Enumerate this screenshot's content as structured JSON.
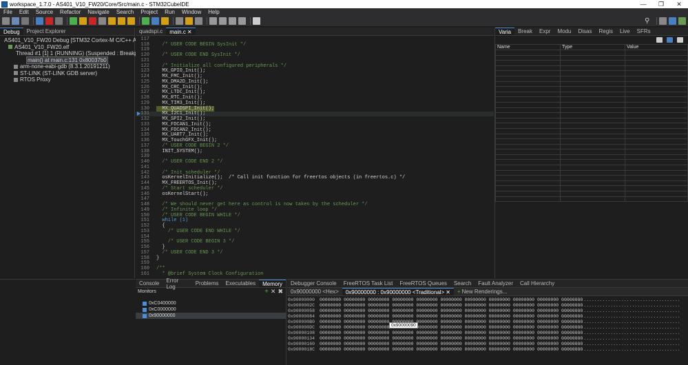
{
  "window": {
    "title": "workspace_1.7.0 - AS401_V10_FW20/Core/Src/main.c - STM32CubeIDE"
  },
  "menu": [
    "File",
    "Edit",
    "Source",
    "Refactor",
    "Navigate",
    "Search",
    "Project",
    "Run",
    "Window",
    "Help"
  ],
  "debug_panel": {
    "tabs": [
      "Debug",
      "Project Explorer"
    ],
    "tree": [
      {
        "label": "AS401_V10_FW20 Debug [STM32 Cortex-M C/C++ Application]",
        "indent": 0
      },
      {
        "label": "AS401_V10_FW20.elf",
        "indent": 1
      },
      {
        "label": "Thread #1 [1] 1 (RUNNING) (Suspended : Breakpoint)",
        "indent": 2
      },
      {
        "label": "main() at main.c:131 0x80037b0",
        "indent": 3
      },
      {
        "label": "arm-none-eabi-gdb (8.3.1.20191211)",
        "indent": 1
      },
      {
        "label": "ST-LINK (ST-LINK GDB server)",
        "indent": 1
      },
      {
        "label": "RTOS Proxy",
        "indent": 1
      }
    ]
  },
  "editor": {
    "tabs": [
      "quadspi.c",
      "main.c"
    ],
    "lines": [
      {
        "n": "117",
        "t": ""
      },
      {
        "n": "118",
        "t": "  /* USER CODE BEGIN SysInit */"
      },
      {
        "n": "119",
        "t": ""
      },
      {
        "n": "120",
        "t": "  /* USER CODE END SysInit */"
      },
      {
        "n": "121",
        "t": ""
      },
      {
        "n": "122",
        "t": "  /* Initialize all configured peripherals */"
      },
      {
        "n": "123",
        "t": "  MX_GPIO_Init();"
      },
      {
        "n": "124",
        "t": "  MX_FMC_Init();"
      },
      {
        "n": "125",
        "t": "  MX_DMA2D_Init();"
      },
      {
        "n": "126",
        "t": "  MX_CRC_Init();"
      },
      {
        "n": "127",
        "t": "  MX_LTDC_Init();"
      },
      {
        "n": "128",
        "t": "  MX_RTC_Init();"
      },
      {
        "n": "129",
        "t": "  MX_TIM3_Init();"
      },
      {
        "n": "130",
        "t": "  MX_QUADSPI_Init();"
      },
      {
        "n": "131",
        "t": "  MX_I2C1_Init();"
      },
      {
        "n": "132",
        "t": "  MX_SPI2_Init();"
      },
      {
        "n": "133",
        "t": "  MX_FDCAN1_Init();"
      },
      {
        "n": "134",
        "t": "  MX_FDCAN2_Init();"
      },
      {
        "n": "135",
        "t": "  MX_UART7_Init();"
      },
      {
        "n": "136",
        "t": "  MX_TouchGFX_Init();"
      },
      {
        "n": "137",
        "t": "  /* USER CODE BEGIN 2 */"
      },
      {
        "n": "138",
        "t": "  INIT_SYSTEM();"
      },
      {
        "n": "139",
        "t": ""
      },
      {
        "n": "140",
        "t": "  /* USER CODE END 2 */"
      },
      {
        "n": "141",
        "t": ""
      },
      {
        "n": "142",
        "t": "  /* Init scheduler */"
      },
      {
        "n": "143",
        "t": "  osKernelInitialize();  /* Call init function for freertos objects (in freertos.c) */"
      },
      {
        "n": "144",
        "t": "  MX_FREERTOS_Init();"
      },
      {
        "n": "145",
        "t": "  /* Start scheduler */"
      },
      {
        "n": "146",
        "t": "  osKernelStart();"
      },
      {
        "n": "147",
        "t": ""
      },
      {
        "n": "148",
        "t": "  /* We should never get here as control is now taken by the scheduler */"
      },
      {
        "n": "149",
        "t": "  /* Infinite loop */"
      },
      {
        "n": "150",
        "t": "  /* USER CODE BEGIN WHILE */"
      },
      {
        "n": "151",
        "t": "  while (1)"
      },
      {
        "n": "152",
        "t": "  {"
      },
      {
        "n": "153",
        "t": "    /* USER CODE END WHILE */"
      },
      {
        "n": "154",
        "t": ""
      },
      {
        "n": "155",
        "t": "    /* USER CODE BEGIN 3 */"
      },
      {
        "n": "156",
        "t": "  }"
      },
      {
        "n": "157",
        "t": "  /* USER CODE END 3 */"
      },
      {
        "n": "158",
        "t": "}"
      },
      {
        "n": "159",
        "t": ""
      },
      {
        "n": "160",
        "t": "/**"
      },
      {
        "n": "161",
        "t": "  * @brief System Clock Configuration"
      }
    ]
  },
  "vars_panel": {
    "tabs": [
      "Varia",
      "Break",
      "Expr",
      "Modu",
      "Disas",
      "Regis",
      "Live",
      "SFRs"
    ],
    "columns": [
      "Name",
      "Type",
      "Value"
    ]
  },
  "bottom_left": {
    "tabs": [
      "Console",
      "Error Log",
      "Problems",
      "Executables",
      "Memory"
    ],
    "monitors_label": "Monitors",
    "monitors": [
      "0xC0400000",
      "0xC0000000",
      "0x90000000"
    ]
  },
  "bottom_right": {
    "tabs": [
      "Debugger Console",
      "FreeRTOS Task List",
      "FreeRTOS Queues",
      "Search",
      "Fault Analyzer",
      "Call Hierarchy"
    ],
    "render_tabs": [
      "0x90000000 <Hex>",
      "0x90000000 : 0x90000000 <Traditional>",
      "New Renderings..."
    ],
    "tooltip": "0x90000090",
    "rows": [
      {
        "addr": "0x90000000",
        "hex": "00000000 00000000 00000000 00000000 00000000 00000000 00000000 00000000 00000000 00000000 00000000",
        "ascii": "............................................"
      },
      {
        "addr": "0x9000002C",
        "hex": "00000000 00000000 00000000 00000000 00000000 00000000 00000000 00000000 00000000 00000000 00000000",
        "ascii": "............................................"
      },
      {
        "addr": "0x90000058",
        "hex": "00000000 00000000 00000000 00000000 00000000 00000000 00000000 00000000 00000000 00000000 00000000",
        "ascii": "............................................"
      },
      {
        "addr": "0x90000084",
        "hex": "00000000 00000000 00000000 00000000 00000000 00000000 00000000 00000000 00000000 00000000 00000000",
        "ascii": "............................................"
      },
      {
        "addr": "0x900000B0",
        "hex": "00000000 00000000 00000000 00000000 00000000 00000000 00000000 00000000 00000000 00000000 00000000",
        "ascii": "............................................"
      },
      {
        "addr": "0x900000DC",
        "hex": "00000000 00000000 00000000 00000000 00000000 00000000 00000000 00000000 00000000 00000000 00000000",
        "ascii": "............................................"
      },
      {
        "addr": "0x90000108",
        "hex": "00000000 00000000 00000000 00000000 00000000 00000000 00000000 00000000 00000000 00000000 00000000",
        "ascii": "............................................"
      },
      {
        "addr": "0x90000134",
        "hex": "00000000 00000000 00000000 00000000 00000000 00000000 00000000 00000000 00000000 00000000 00000000",
        "ascii": "............................................"
      },
      {
        "addr": "0x90000160",
        "hex": "00000000 00000000 00000000 00000000 00000000 00000000 00000000 00000000 00000000 00000000 00000000",
        "ascii": "............................................"
      },
      {
        "addr": "0x9000018C",
        "hex": "00000000 00000000 00000000 00000000 00000000 00000000 00000000 00000000 00000000 00000000 00000000",
        "ascii": "............................................"
      }
    ]
  }
}
